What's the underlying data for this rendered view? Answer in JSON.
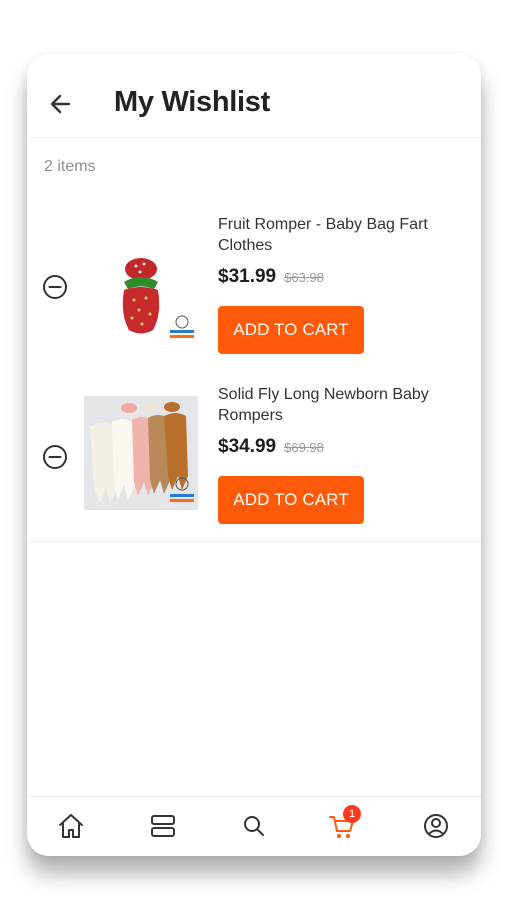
{
  "header": {
    "title": "My Wishlist",
    "back_icon": "arrow-left-icon"
  },
  "summary": {
    "item_count": "2 items"
  },
  "items": [
    {
      "name": "Fruit Romper - Baby Bag Fart Clothes",
      "price": "$31.99",
      "old_price": "$63.98",
      "button_label": "ADD TO CART",
      "image": "strawberry-romper-image"
    },
    {
      "name": "Solid Fly Long Newborn Baby Rompers",
      "price": "$34.99",
      "old_price": "$69.98",
      "button_label": "ADD TO CART",
      "image": "newborn-rompers-image"
    }
  ],
  "nav": {
    "items": [
      "home-icon",
      "categories-icon",
      "search-icon",
      "cart-icon",
      "profile-icon"
    ],
    "cart_badge": "1",
    "active": "cart"
  },
  "colors": {
    "accent": "#ff5a0a",
    "badge": "#ff3b1f",
    "text": "#222222",
    "muted": "#8e8e8e"
  }
}
